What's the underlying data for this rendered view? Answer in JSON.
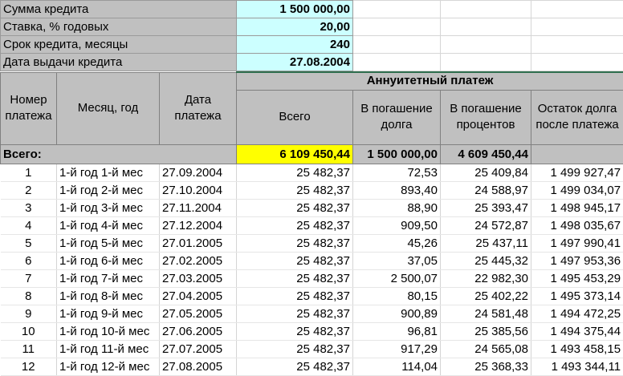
{
  "params": [
    {
      "label": "Сумма кредита",
      "value": "1 500 000,00"
    },
    {
      "label": "Ставка, % годовых",
      "value": "20,00"
    },
    {
      "label": "Срок кредита, месяцы",
      "value": "240"
    },
    {
      "label": "Дата выдачи кредита",
      "value": "27.08.2004"
    }
  ],
  "headers": {
    "num": "Номер платежа",
    "month": "Месяц, год",
    "date": "Дата платежа",
    "annuity": "Аннуитетный платеж",
    "total": "Всего",
    "principal": "В погашение долга",
    "interest": "В погашение процентов",
    "remaining": "Остаток долга после платежа"
  },
  "totals": {
    "label": "Всего:",
    "total": "6 109 450,44",
    "principal": "1 500 000,00",
    "interest": "4 609 450,44"
  },
  "rows": [
    {
      "n": "1",
      "month": "1-й год 1-й мес",
      "date": "27.09.2004",
      "total": "25 482,37",
      "principal": "72,53",
      "interest": "25 409,84",
      "remaining": "1 499 927,47"
    },
    {
      "n": "2",
      "month": "1-й год 2-й мес",
      "date": "27.10.2004",
      "total": "25 482,37",
      "principal": "893,40",
      "interest": "24 588,97",
      "remaining": "1 499 034,07"
    },
    {
      "n": "3",
      "month": "1-й год 3-й мес",
      "date": "27.11.2004",
      "total": "25 482,37",
      "principal": "88,90",
      "interest": "25 393,47",
      "remaining": "1 498 945,17"
    },
    {
      "n": "4",
      "month": "1-й год 4-й мес",
      "date": "27.12.2004",
      "total": "25 482,37",
      "principal": "909,50",
      "interest": "24 572,87",
      "remaining": "1 498 035,67"
    },
    {
      "n": "5",
      "month": "1-й год 5-й мес",
      "date": "27.01.2005",
      "total": "25 482,37",
      "principal": "45,26",
      "interest": "25 437,11",
      "remaining": "1 497 990,41"
    },
    {
      "n": "6",
      "month": "1-й год 6-й мес",
      "date": "27.02.2005",
      "total": "25 482,37",
      "principal": "37,05",
      "interest": "25 445,32",
      "remaining": "1 497 953,36"
    },
    {
      "n": "7",
      "month": "1-й год 7-й мес",
      "date": "27.03.2005",
      "total": "25 482,37",
      "principal": "2 500,07",
      "interest": "22 982,30",
      "remaining": "1 495 453,29"
    },
    {
      "n": "8",
      "month": "1-й год 8-й мес",
      "date": "27.04.2005",
      "total": "25 482,37",
      "principal": "80,15",
      "interest": "25 402,22",
      "remaining": "1 495 373,14"
    },
    {
      "n": "9",
      "month": "1-й год 9-й мес",
      "date": "27.05.2005",
      "total": "25 482,37",
      "principal": "900,89",
      "interest": "24 581,48",
      "remaining": "1 494 472,25"
    },
    {
      "n": "10",
      "month": "1-й год 10-й мес",
      "date": "27.06.2005",
      "total": "25 482,37",
      "principal": "96,81",
      "interest": "25 385,56",
      "remaining": "1 494 375,44"
    },
    {
      "n": "11",
      "month": "1-й год 11-й мес",
      "date": "27.07.2005",
      "total": "25 482,37",
      "principal": "917,29",
      "interest": "24 565,08",
      "remaining": "1 493 458,15"
    },
    {
      "n": "12",
      "month": "1-й год 12-й мес",
      "date": "27.08.2005",
      "total": "25 482,37",
      "principal": "114,04",
      "interest": "25 368,33",
      "remaining": "1 493 344,11"
    }
  ]
}
